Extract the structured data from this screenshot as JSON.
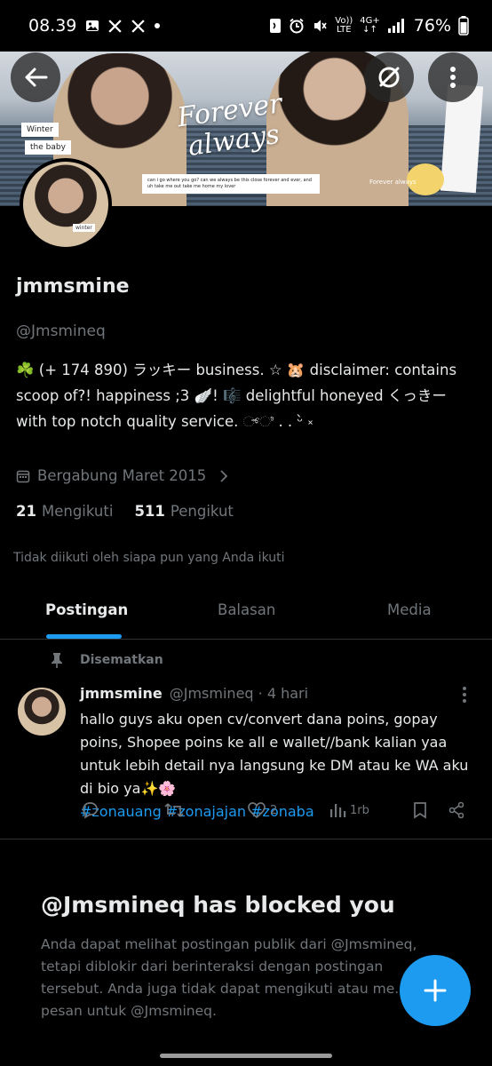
{
  "status_bar": {
    "time": "08.39",
    "left_icons": [
      "image-icon",
      "x-logo-icon",
      "x-logo-icon",
      "dot-icon"
    ],
    "volte_top": "Vo))",
    "volte_bottom": "LTE",
    "network_top": "4G+",
    "network_bottom": "↓↑",
    "battery": "76%"
  },
  "banner": {
    "script_text": "Forever always",
    "tag_left_1": "Winter",
    "tag_left_2": "the baby",
    "caption": "can i go where you go? can we always be this close forever and ever, and uh take me out take me home my lover",
    "tag_right": "Forever always"
  },
  "avatar": {
    "tag": "winter"
  },
  "profile": {
    "display_name": "jmmsmine",
    "handle": "@Jmsmineq",
    "bio": "☘️ (+ 174 890) ラッキー business. ☆ 🐹 disclaimer: contains scoop of?! happiness ;3 🪽! 🎼 delightful honeyed くっきー with top notch quality service. ್ಿ . . ᵕ̀ ༝",
    "joined": "Bergabung Maret 2015",
    "following_count": "21",
    "following_label": "Mengikuti",
    "followers_count": "511",
    "followers_label": "Pengikut",
    "not_followed": "Tidak diikuti oleh siapa pun yang Anda ikuti"
  },
  "tabs": [
    {
      "label": "Postingan",
      "active": true
    },
    {
      "label": "Balasan",
      "active": false
    },
    {
      "label": "Media",
      "active": false
    }
  ],
  "pinned_post": {
    "pinned_label": "Disematkan",
    "name": "jmmsmine",
    "handle_time": "@Jmsmineq · 4 hari",
    "text": "hallo guys aku open cv/convert dana poins, gopay poins, Shopee poins ke all e wallet//bank kalian yaa untuk  lebih detail nya langsung ke DM atau ke WA aku di bio ya✨🌸",
    "hashtags": "#zonauang #zonajajan #zonaba",
    "likes": "2",
    "views": "1rb"
  },
  "blocked": {
    "title": "@Jmsmineq has blocked you",
    "text": "Anda dapat melihat postingan publik dari @Jmsmineq, tetapi diblokir dari berinteraksi dengan postingan tersebut. Anda juga tidak dapat mengikuti atau me... pesan untuk @Jmsmineq."
  },
  "colors": {
    "background": "#000000",
    "accent": "#1d9bf0",
    "secondary_text": "#71767b",
    "primary_text": "#e7e9ea"
  }
}
